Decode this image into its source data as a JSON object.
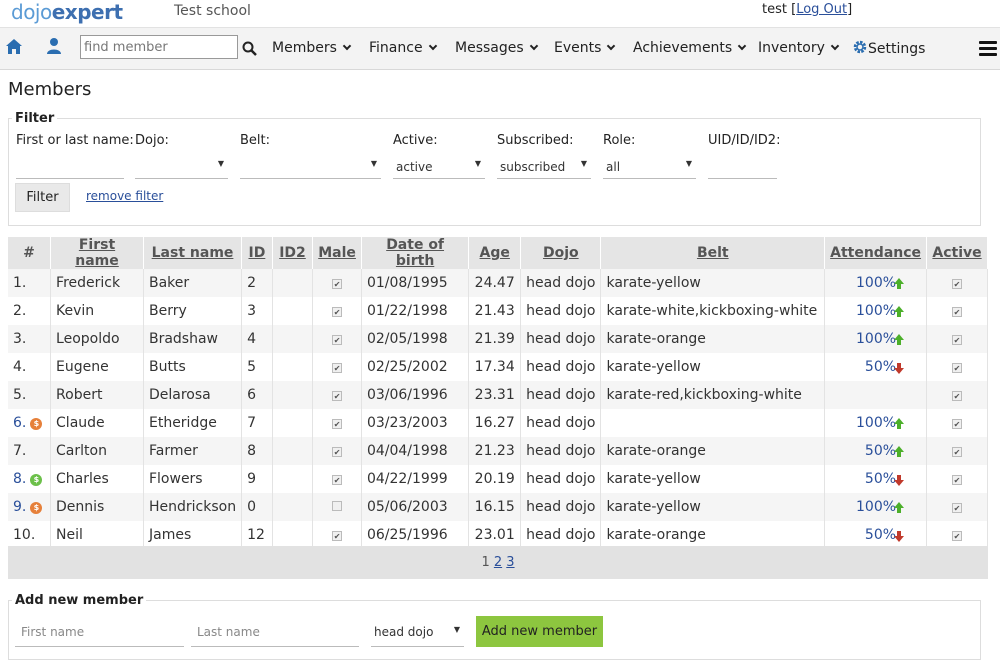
{
  "header": {
    "logo_a": "dojo",
    "logo_b": "expert",
    "school": "Test school",
    "user": "test",
    "logout": "Log Out"
  },
  "nav": {
    "search_placeholder": "find member",
    "menus": [
      "Members",
      "Finance",
      "Messages",
      "Events",
      "Achievements",
      "Inventory"
    ],
    "settings": "Settings",
    "icons": [
      "home-icon",
      "user-icon",
      "search-icon",
      "gear-icon",
      "hamburger-icon"
    ]
  },
  "page_title": "Members",
  "filter": {
    "legend": "Filter",
    "name_label": "First or last name:",
    "dojo_label": "Dojo:",
    "belt_label": "Belt:",
    "active_label": "Active:",
    "active_value": "active",
    "subscribed_label": "Subscribed:",
    "subscribed_value": "subscribed",
    "role_label": "Role:",
    "role_value": "all",
    "uid_label": "UID/ID/ID2:",
    "filter_button": "Filter",
    "remove_filter": "remove filter"
  },
  "table": {
    "headers": [
      "#",
      "First name",
      "Last name",
      "ID",
      "ID2",
      "Male",
      "Date of birth",
      "Age",
      "Dojo",
      "Belt",
      "Attendance",
      "Active"
    ],
    "rows": [
      {
        "idx": "1.",
        "first": "Frederick",
        "last": "Baker",
        "id": "2",
        "id2": "",
        "male": true,
        "dob": "01/08/1995",
        "age": "24.47",
        "dojo": "head dojo",
        "belt": "karate-yellow",
        "att": "100%",
        "trend": "up",
        "active": true,
        "badge": ""
      },
      {
        "idx": "2.",
        "first": "Kevin",
        "last": "Berry",
        "id": "3",
        "id2": "",
        "male": true,
        "dob": "01/22/1998",
        "age": "21.43",
        "dojo": "head dojo",
        "belt": "karate-white,kickboxing-white",
        "att": "100%",
        "trend": "up",
        "active": true,
        "badge": ""
      },
      {
        "idx": "3.",
        "first": "Leopoldo",
        "last": "Bradshaw",
        "id": "4",
        "id2": "",
        "male": true,
        "dob": "02/05/1998",
        "age": "21.39",
        "dojo": "head dojo",
        "belt": "karate-orange",
        "att": "100%",
        "trend": "up",
        "active": true,
        "badge": ""
      },
      {
        "idx": "4.",
        "first": "Eugene",
        "last": "Butts",
        "id": "5",
        "id2": "",
        "male": true,
        "dob": "02/25/2002",
        "age": "17.34",
        "dojo": "head dojo",
        "belt": "karate-yellow",
        "att": "50%",
        "trend": "down",
        "active": true,
        "badge": ""
      },
      {
        "idx": "5.",
        "first": "Robert",
        "last": "Delarosa",
        "id": "6",
        "id2": "",
        "male": true,
        "dob": "03/06/1996",
        "age": "23.31",
        "dojo": "head dojo",
        "belt": "karate-red,kickboxing-white",
        "att": "",
        "trend": "",
        "active": true,
        "badge": ""
      },
      {
        "idx": "6.",
        "first": "Claude",
        "last": "Etheridge",
        "id": "7",
        "id2": "",
        "male": true,
        "dob": "03/23/2003",
        "age": "16.27",
        "dojo": "head dojo",
        "belt": "",
        "att": "100%",
        "trend": "up",
        "active": true,
        "badge": "orange"
      },
      {
        "idx": "7.",
        "first": "Carlton",
        "last": "Farmer",
        "id": "8",
        "id2": "",
        "male": true,
        "dob": "04/04/1998",
        "age": "21.23",
        "dojo": "head dojo",
        "belt": "karate-orange",
        "att": "50%",
        "trend": "up",
        "active": true,
        "badge": ""
      },
      {
        "idx": "8.",
        "first": "Charles",
        "last": "Flowers",
        "id": "9",
        "id2": "",
        "male": true,
        "dob": "04/22/1999",
        "age": "20.19",
        "dojo": "head dojo",
        "belt": "karate-yellow",
        "att": "50%",
        "trend": "down",
        "active": true,
        "badge": "green"
      },
      {
        "idx": "9.",
        "first": "Dennis",
        "last": "Hendrickson",
        "id": "0",
        "id2": "",
        "male": false,
        "dob": "05/06/2003",
        "age": "16.15",
        "dojo": "head dojo",
        "belt": "karate-yellow",
        "att": "100%",
        "trend": "up",
        "active": true,
        "badge": "orange"
      },
      {
        "idx": "10.",
        "first": "Neil",
        "last": "James",
        "id": "12",
        "id2": "",
        "male": true,
        "dob": "06/25/1996",
        "age": "23.01",
        "dojo": "head dojo",
        "belt": "karate-orange",
        "att": "50%",
        "trend": "down",
        "active": true,
        "badge": ""
      }
    ]
  },
  "pager": {
    "current": "1",
    "pages": [
      "2",
      "3"
    ]
  },
  "add_member": {
    "legend": "Add new member",
    "first_placeholder": "First name",
    "last_placeholder": "Last name",
    "dojo_value": "head dojo",
    "button": "Add new member"
  },
  "colors": {
    "accent_green": "#8dc63f",
    "link_blue": "#2a4f9a",
    "trend_up": "#4caf2a",
    "trend_down": "#c0392b"
  }
}
